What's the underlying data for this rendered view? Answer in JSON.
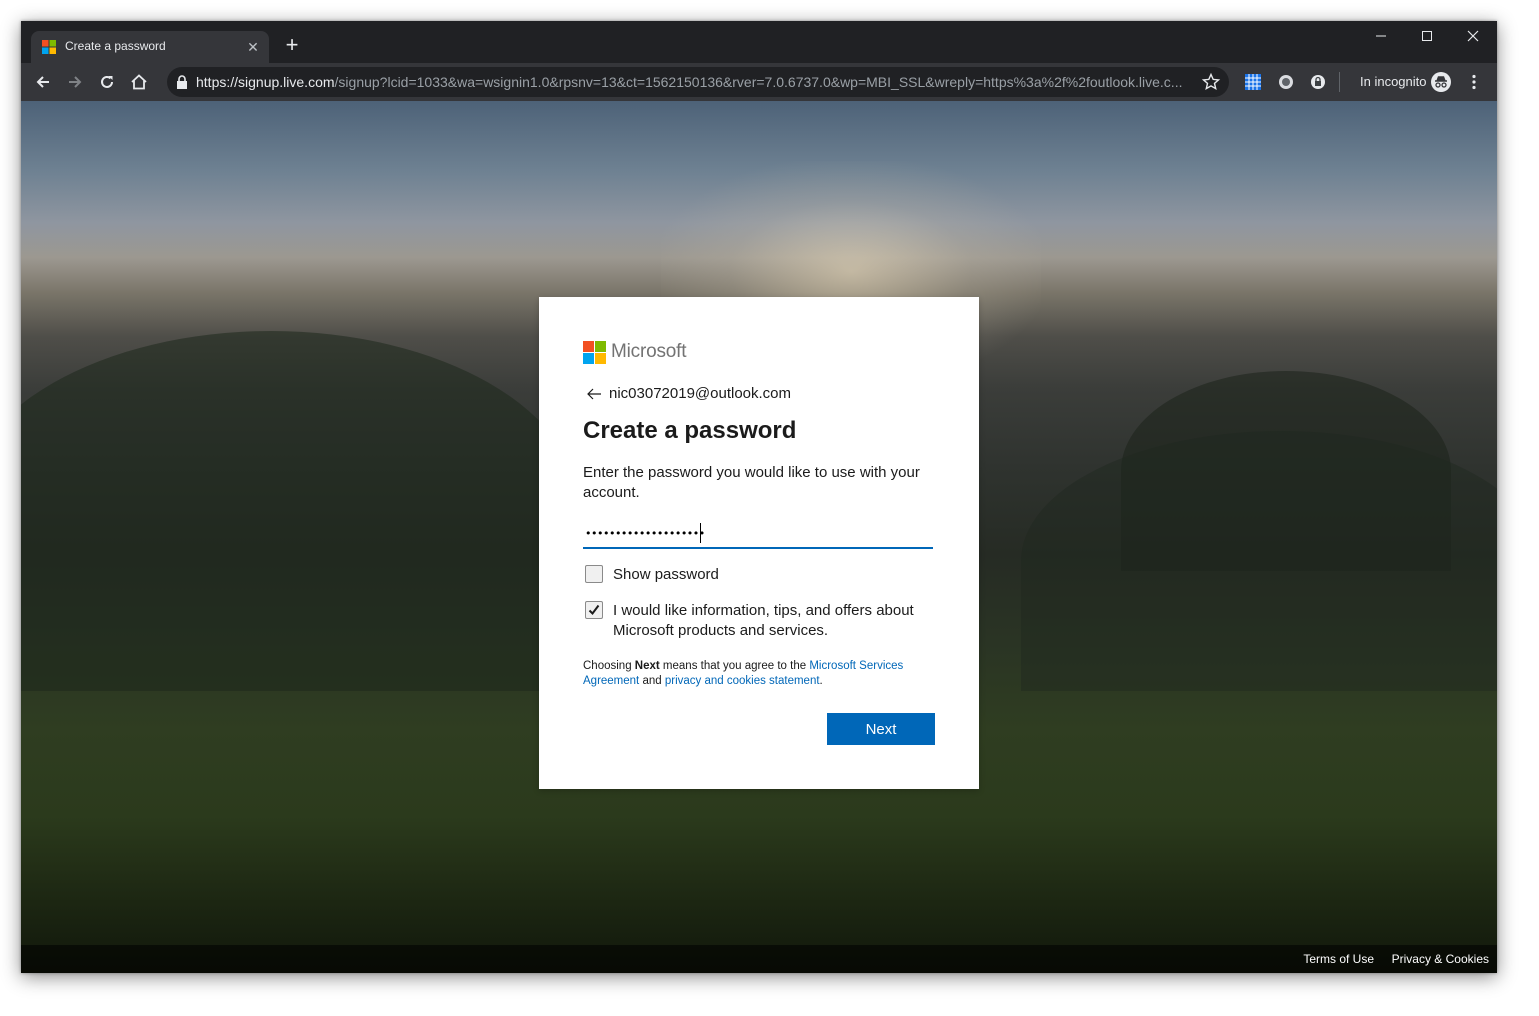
{
  "browser": {
    "tab": {
      "title": "Create a password",
      "favicon": "microsoft-favicon",
      "close_label": "✕"
    },
    "new_tab_label": "+",
    "window_controls": [
      "minimize-icon",
      "maximize-icon",
      "close-icon"
    ],
    "toolbar": {
      "back": "arrow-left-icon",
      "forward": "arrow-right-icon",
      "reload": "reload-icon",
      "home": "home-icon"
    },
    "url": {
      "scheme": "https://",
      "host": "signup.live.com",
      "path": "/signup?lcid=1033&wa=wsignin1.0&rpsnv=13&ct=1562150136&rver=7.0.6737.0&wp=MBI_SSL&wreply=https%3a%2f%2foutlook.live.c..."
    },
    "incognito_label": "In incognito"
  },
  "card": {
    "brand": "Microsoft",
    "identity": "nic03072019@outlook.com",
    "title": "Create a password",
    "description": "Enter the password you would like to use with your account.",
    "password_value": "••••••••••••••••••••",
    "show_password_label": "Show password",
    "show_password_checked": false,
    "marketing_label": "I would like information, tips, and offers about Microsoft products and services.",
    "marketing_checked": true,
    "legal": {
      "prefix": "Choosing ",
      "bold": "Next",
      "middle": " means that you agree to the ",
      "link1": "Microsoft Services Agreement",
      "and": " and ",
      "link2": "privacy and cookies statement",
      "suffix": "."
    },
    "next_label": "Next"
  },
  "footer": {
    "terms": "Terms of Use",
    "privacy": "Privacy & Cookies"
  },
  "colors": {
    "accent": "#0067b8",
    "ms_red": "#f25022",
    "ms_green": "#7fba00",
    "ms_blue": "#00a4ef",
    "ms_yellow": "#ffb900"
  }
}
